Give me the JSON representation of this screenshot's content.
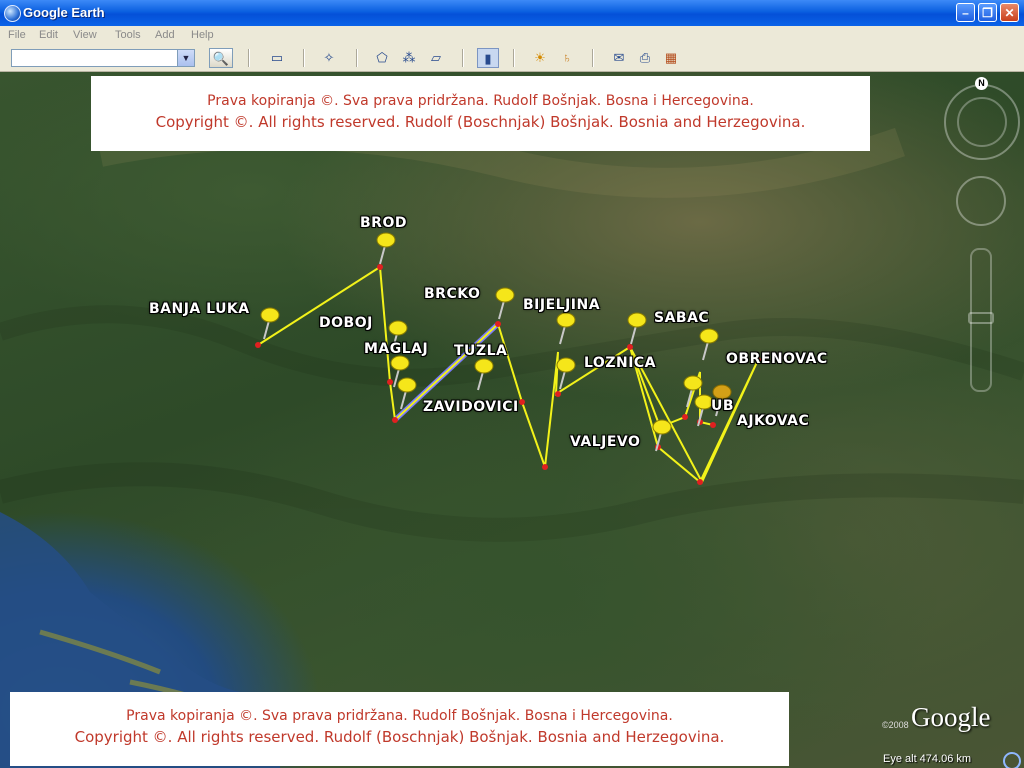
{
  "window": {
    "title": "Google Earth"
  },
  "menu": {
    "file": "File",
    "edit": "Edit",
    "view": "View",
    "tools": "Tools",
    "add": "Add",
    "help": "Help"
  },
  "toolbar": {
    "search_value": ""
  },
  "banner_top": {
    "line1": "Prava kopiranja ©.  Sva prava pridržana.  Rudolf Bošnjak. Bosna i Hercegovina.",
    "line2": "Copyright ©.  All rights reserved.  Rudolf (Boschnjak) Bošnjak. Bosnia and Herzegovina."
  },
  "banner_bottom": {
    "line1": "Prava kopiranja ©.  Sva prava pridržana.  Rudolf Bošnjak. Bosna i Hercegovina.",
    "line2": "Copyright ©.  All rights reserved.  Rudolf (Boschnjak) Bošnjak. Bosnia and Herzegovina."
  },
  "places": {
    "brod": "BROD",
    "banja_luka": "BANJA LUKA",
    "doboj": "DOBOJ",
    "maglaj": "MAGLAJ",
    "brcko": "BRCKO",
    "tuzla": "TUZLA",
    "bijeljina": "BIJELJINA",
    "sabac": "SABAC",
    "loznica": "LOZNICA",
    "obrenovac": "OBRENOVAC",
    "zavidovici": "ZAVIDOVICI",
    "valjevo": "VALJEVO",
    "ub": "UB",
    "lajkovac": "AJKOVAC"
  },
  "compass": {
    "north": "N"
  },
  "branding": {
    "logo": "Google",
    "year": "©2008"
  },
  "status": {
    "eye_alt": "Eye alt   474.06 km"
  },
  "colors": {
    "route": "#f2f21a",
    "highlight_route": "#7b7bff",
    "banner_text": "#c0392b"
  },
  "icons": [
    "search-icon",
    "sidebar-icon",
    "placemark-icon",
    "polygon-icon",
    "path-icon",
    "overlay-icon",
    "ruler-icon",
    "sun-icon",
    "planet-icon",
    "email-icon",
    "print-icon",
    "map-icon",
    "pushpin-icon"
  ]
}
